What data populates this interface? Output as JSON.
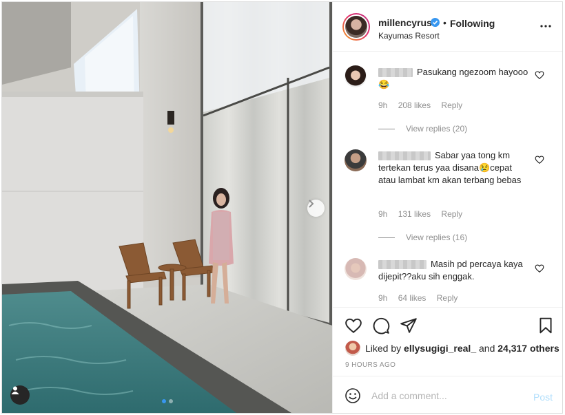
{
  "post": {
    "username": "millencyrus",
    "follow_state": "Following",
    "bullet": "•",
    "location": "Kayumas Resort",
    "photo_description": "",
    "carousel": {
      "count": 2,
      "active": 1
    }
  },
  "comments": [
    {
      "text": "Pasukang ngezoom hayooo😂",
      "age": "9h",
      "likes": "208 likes",
      "reply_label": "Reply",
      "view_replies": "View replies (20)"
    },
    {
      "text": "Sabar yaa tong km tertekan terus yaa disana😢cepat atau lambat km akan terbang bebas",
      "age": "9h",
      "likes": "131 likes",
      "reply_label": "Reply",
      "view_replies": "View replies (16)"
    },
    {
      "text": "Masih pd percaya kaya dijepit??aku sih enggak.",
      "age": "9h",
      "likes": "64 likes",
      "reply_label": "Reply"
    }
  ],
  "likes": {
    "prefix": "Liked by",
    "user": "ellysugigi_real_",
    "and": "and",
    "others": "24,317 others"
  },
  "time_ago": "9 HOURS AGO",
  "add_comment": {
    "placeholder": "Add a comment...",
    "post_label": "Post"
  },
  "colors": {
    "verified": "#3897f0",
    "link_disabled": "#b2dffc",
    "muted": "#8e8e8e"
  },
  "icons": [
    "verified-badge-icon",
    "more-options-icon",
    "heart-icon",
    "comment-icon",
    "share-icon",
    "bookmark-icon",
    "emoji-icon",
    "user-tag-icon",
    "chevron-right-icon"
  ]
}
